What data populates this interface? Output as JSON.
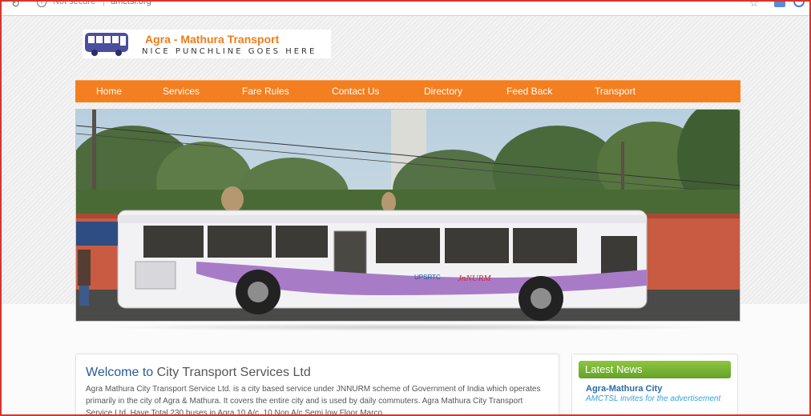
{
  "browser": {
    "security_label": "Not secure",
    "separator": "|",
    "url": "amctsl.org"
  },
  "header": {
    "title": "Agra - Mathura Transport",
    "tagline": "NICE PUNCHLINE GOES HERE"
  },
  "nav": {
    "items": [
      {
        "label": "Home"
      },
      {
        "label": "Services"
      },
      {
        "label": "Fare Rules"
      },
      {
        "label": "Contact Us"
      },
      {
        "label": "Directory"
      },
      {
        "label": "Feed Back"
      },
      {
        "label": "Transport"
      }
    ]
  },
  "hero": {
    "bus_marking_1": "UPSRTC",
    "bus_marking_2": "JnNURM",
    "colors": {
      "sky": "#c5d6e2",
      "wall": "#c95b42",
      "bus_white": "#f2f2f4",
      "bus_stripe": "#a87bc7"
    }
  },
  "welcome": {
    "title_lead": "Welcome to",
    "title_rest": "City Transport Services Ltd",
    "body": "Agra Mathura City Transport Service Ltd. is a city based service under JNNURM scheme of Government of India which operates primarily in the city of Agra & Mathura. It covers the entire city and is used by daily commuters. Agra Mathura City Transport Service Ltd. Have Total 230 buses in Agra 10 A/c, 10 Non A/c Semi low Floor Marco"
  },
  "news": {
    "heading": "Latest News",
    "item_title": "Agra-Mathura City",
    "item_desc": "AMCTSL invites for the advertisement"
  },
  "colors": {
    "nav_orange": "#f47f20",
    "title_orange": "#f07b1b",
    "welcome_blue": "#2a5b8f",
    "news_green": "#7ab33a"
  }
}
